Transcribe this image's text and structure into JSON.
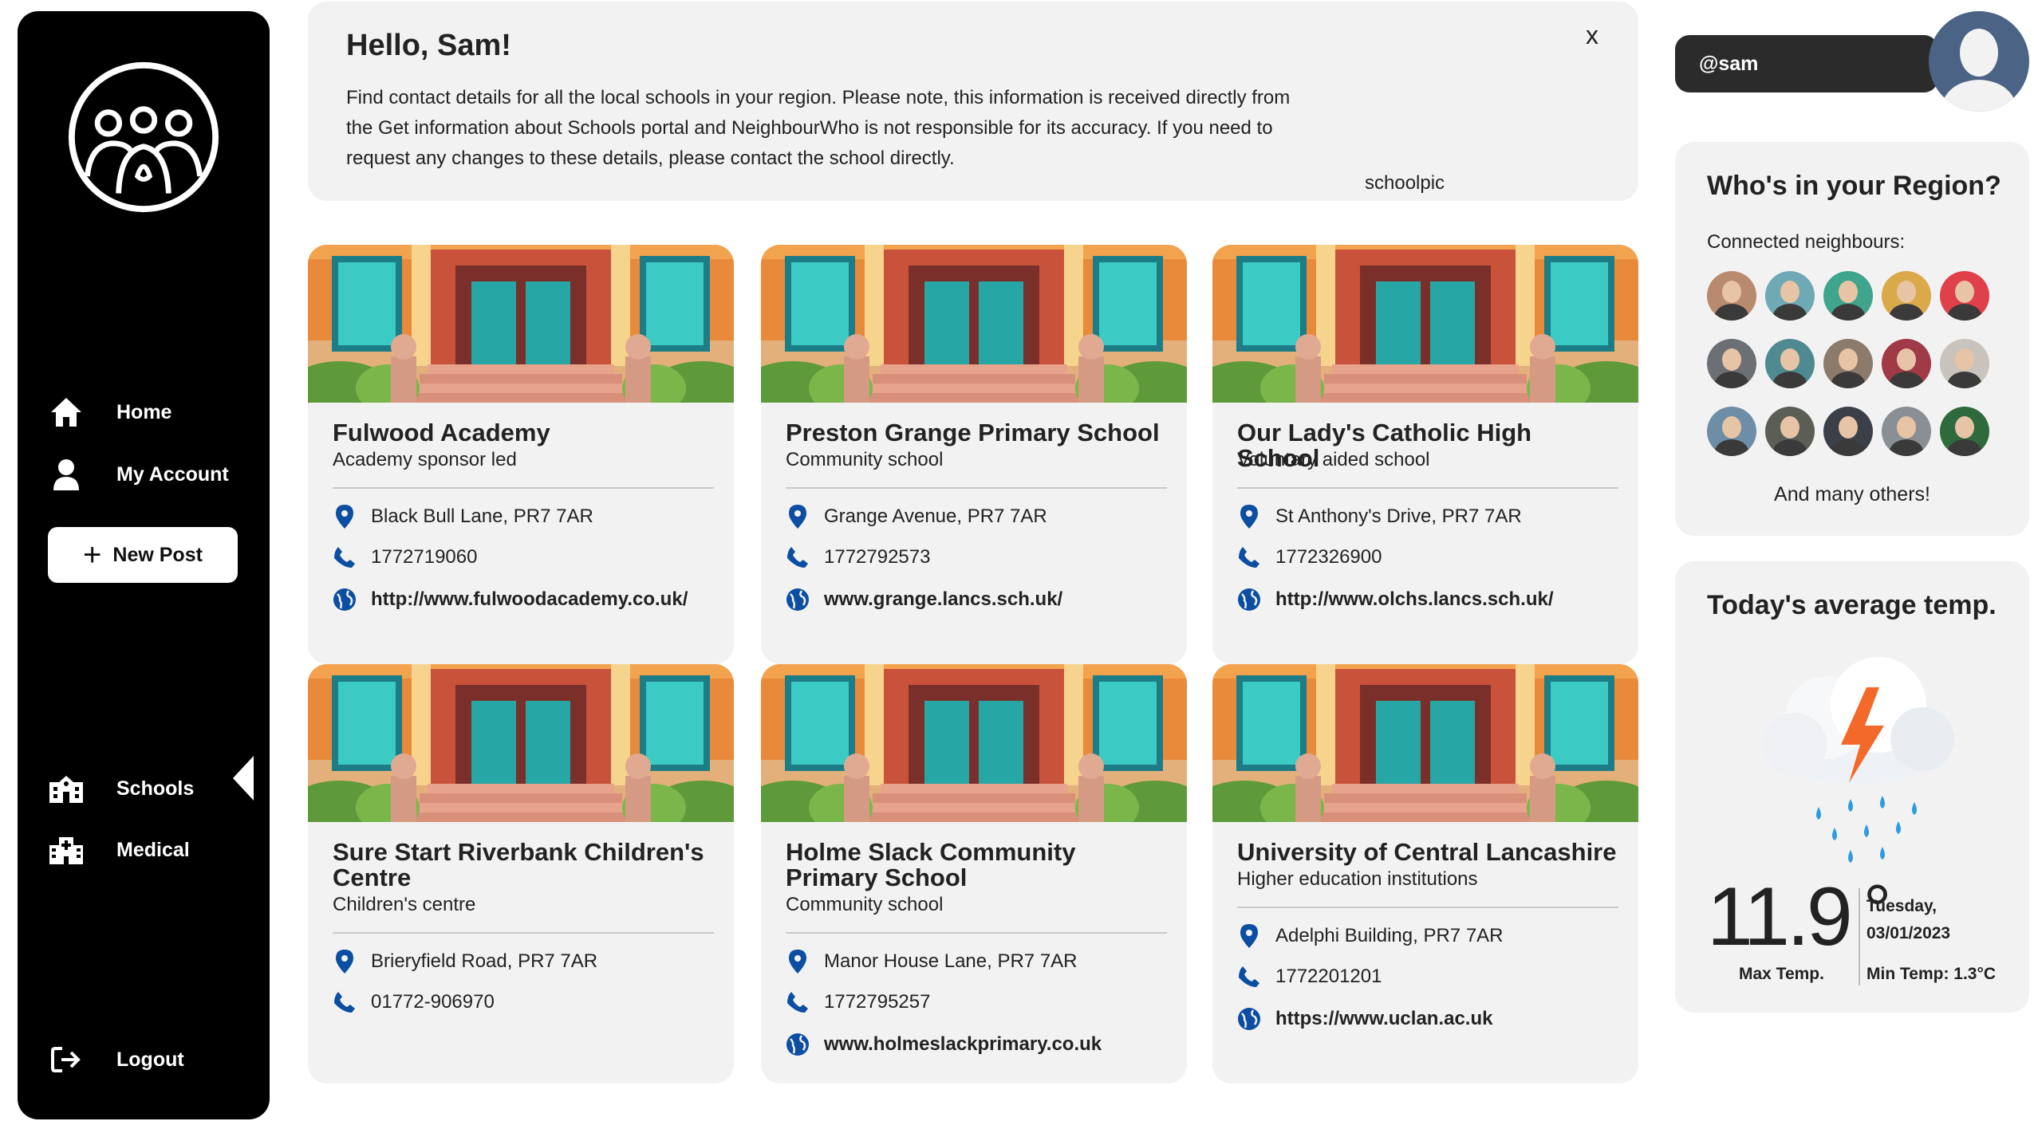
{
  "nav": {
    "home": "Home",
    "account": "My Account",
    "new_post": "New Post",
    "schools": "Schools",
    "medical": "Medical",
    "logout": "Logout"
  },
  "welcome": {
    "title": "Hello, Sam!",
    "message": "Find contact details for all the local schools in your region. Please note, this information is received directly from the Get information about Schools portal and NeighbourWho is not responsible for its accuracy. If you need to request any changes to these details, please contact the school directly.",
    "close": "x",
    "image_alt": "schoolpic"
  },
  "schools": [
    {
      "name": "Fulwood Academy",
      "type": "Academy sponsor led",
      "address": "Black Bull Lane, PR7 7AR",
      "phone": "1772719060",
      "website": "http://www.fulwoodacademy.co.uk/"
    },
    {
      "name": "Preston Grange Primary School",
      "type": "Community school",
      "address": "Grange Avenue, PR7 7AR",
      "phone": "1772792573",
      "website": "www.grange.lancs.sch.uk/"
    },
    {
      "name": "Our Lady's Catholic High School",
      "type": "Voluntary aided school",
      "address": "St Anthony's Drive, PR7 7AR",
      "phone": "1772326900",
      "website": "http://www.olchs.lancs.sch.uk/"
    },
    {
      "name": "Sure Start Riverbank Children's Centre",
      "type": "Children's centre",
      "address": "Brieryfield Road, PR7 7AR",
      "phone": "01772-906970",
      "website": ""
    },
    {
      "name": "Holme Slack Community Primary School",
      "type": "Community school",
      "address": "Manor House Lane, PR7 7AR",
      "phone": "1772795257",
      "website": "www.holmeslackprimary.co.uk"
    },
    {
      "name": "University of Central Lancashire",
      "type": "Higher education institutions",
      "address": "Adelphi Building, PR7 7AR",
      "phone": "1772201201",
      "website": "https://www.uclan.ac.uk"
    }
  ],
  "user": {
    "handle": "@sam"
  },
  "region": {
    "title": "Who's in your Region?",
    "subtitle": "Connected neighbours:",
    "more": "And many others!",
    "neighbour_colors": [
      "#b98b6e",
      "#6fa9b6",
      "#3fa58c",
      "#d9a94a",
      "#e0404a",
      "#6c6f73",
      "#4f8a92",
      "#8c7a6a",
      "#a03a46",
      "#c9c3bd",
      "#6d8ea6",
      "#5b5e55",
      "#3b3f48",
      "#8a8f95",
      "#2f6a3c"
    ]
  },
  "weather": {
    "title": "Today's average temp.",
    "temp": "11.9",
    "degree": "°",
    "day": "Tuesday,",
    "date": "03/01/2023",
    "max_label": "Max Temp.",
    "min_label": "Min Temp: 1.3°C"
  }
}
